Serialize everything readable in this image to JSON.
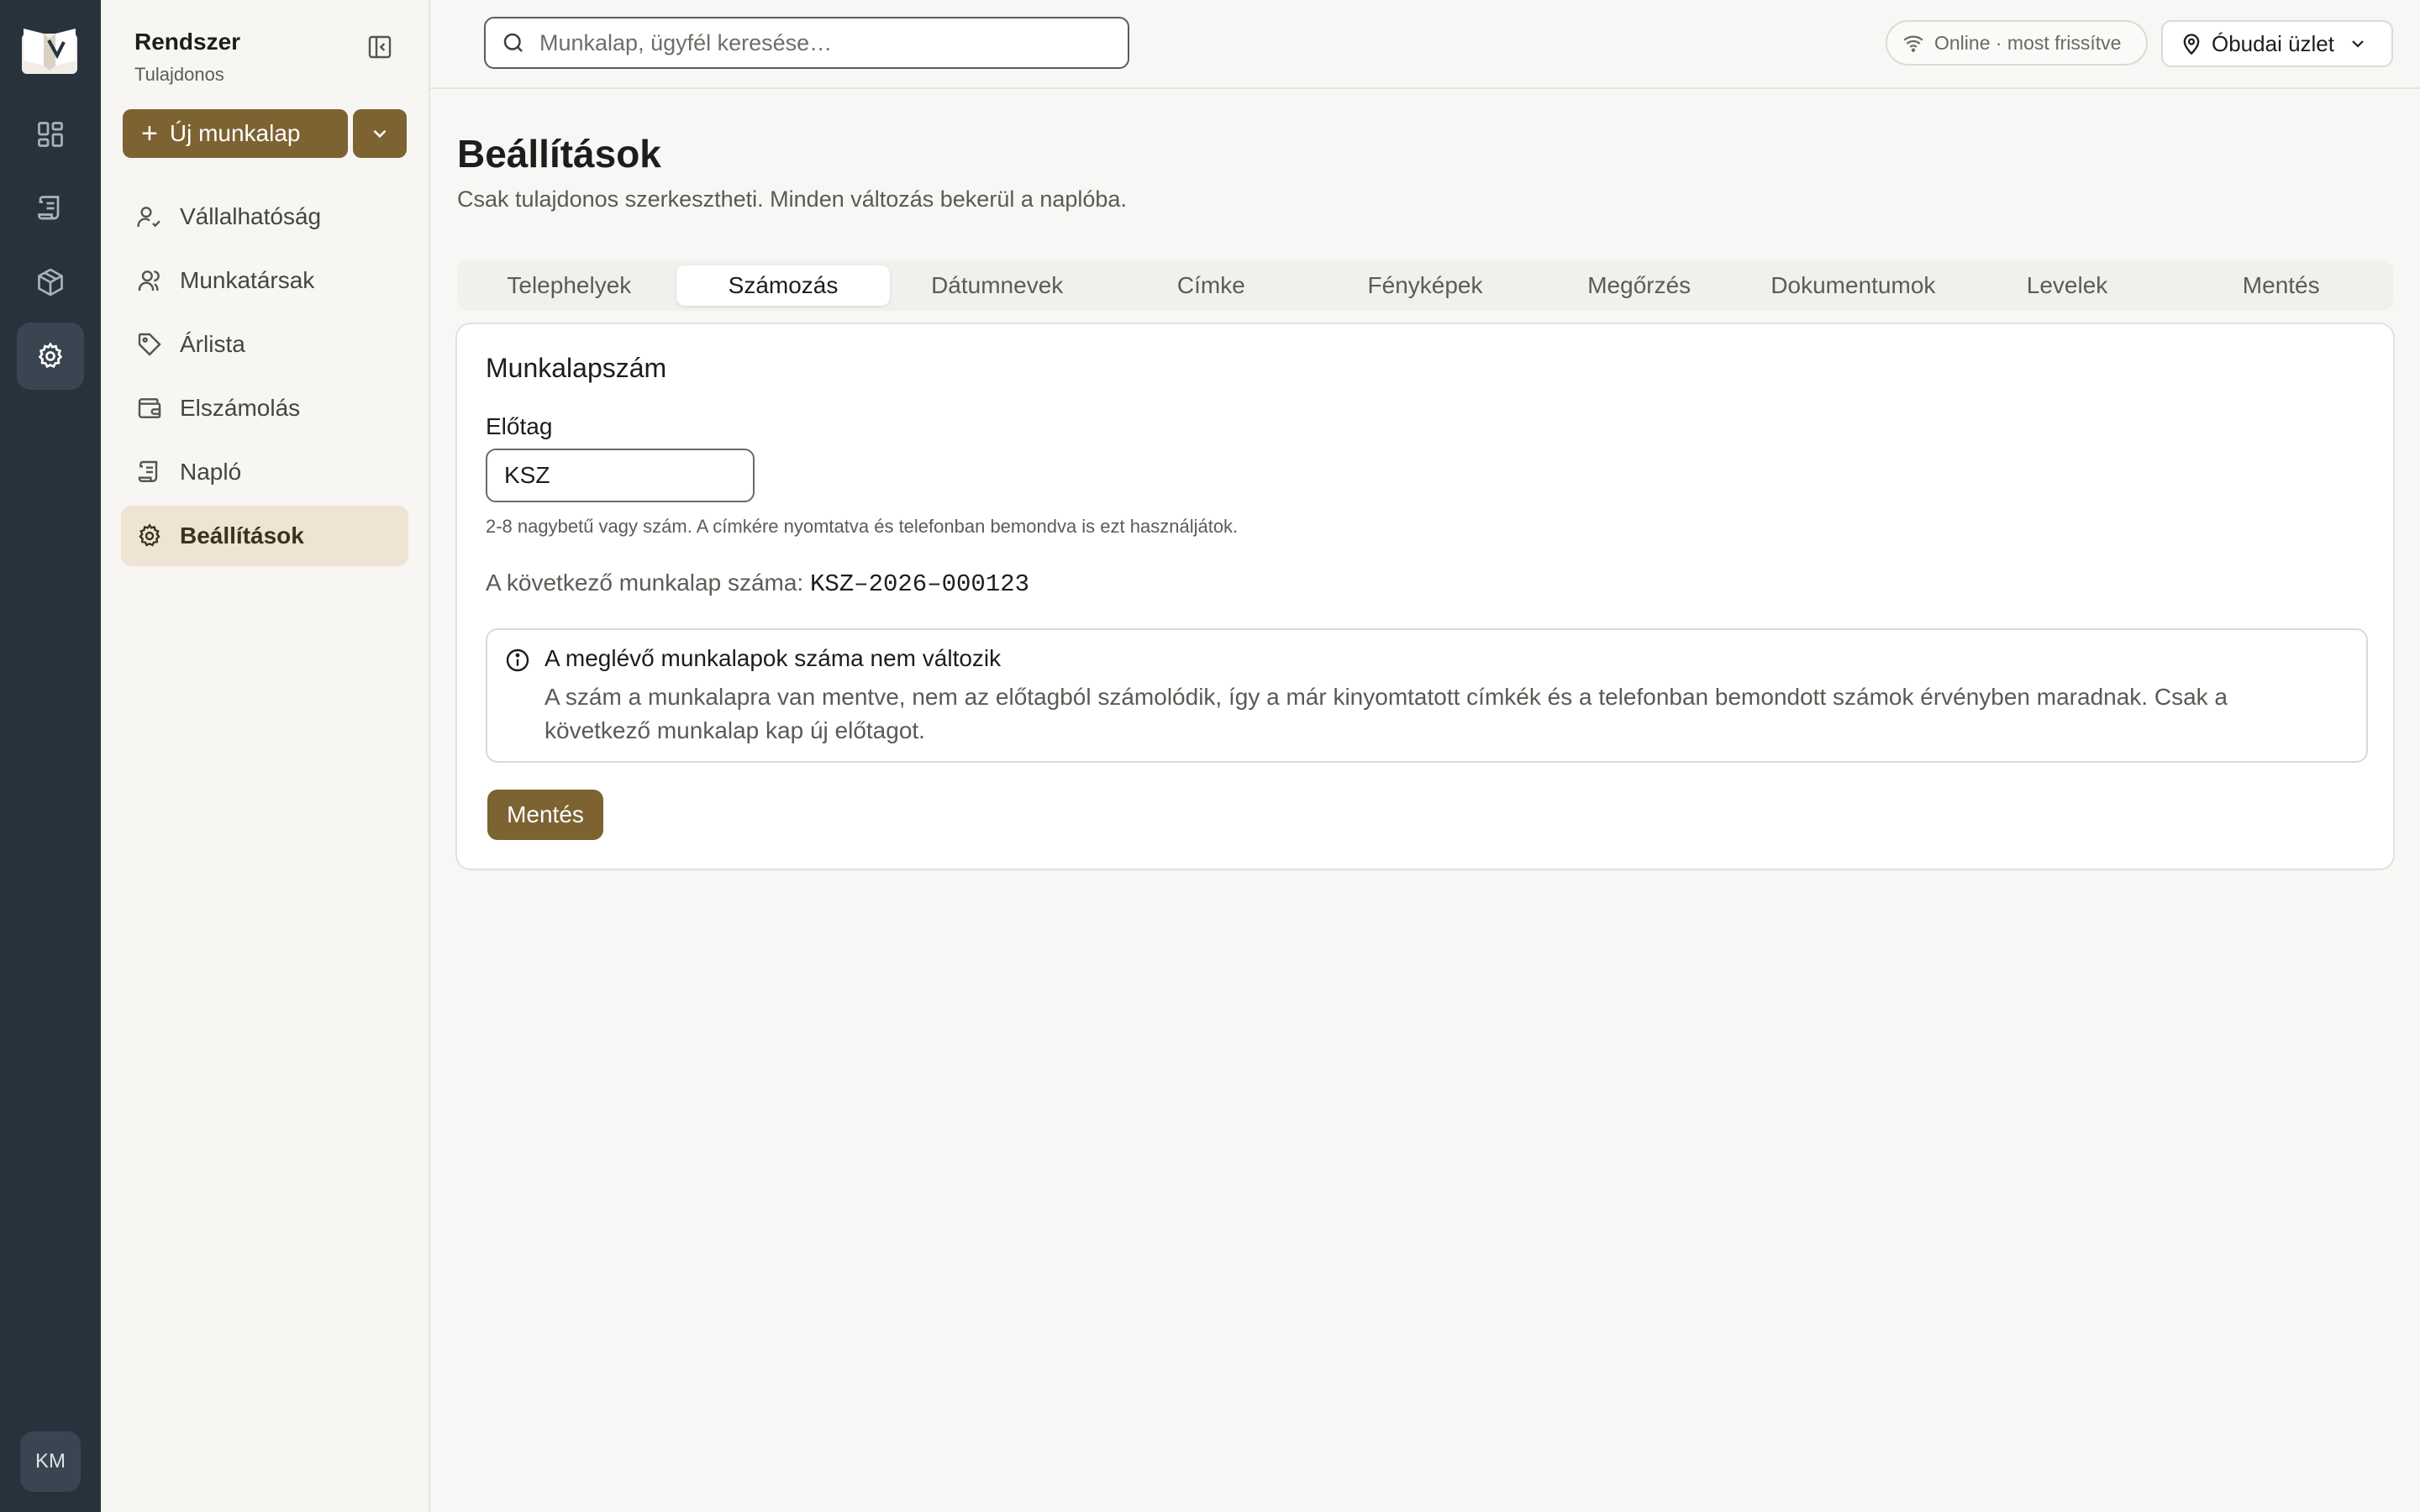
{
  "rail": {
    "items": [
      "dashboard-icon",
      "worksheets-icon",
      "inventory-icon",
      "settings-icon"
    ],
    "active": "settings-icon",
    "avatar_initials": "KM"
  },
  "sidebar": {
    "title": "Rendszer",
    "subtitle": "Tulajdonos",
    "new_button_label": "Új munkalap",
    "items": [
      {
        "label": "Vállalhatóság",
        "icon": "user-check-icon"
      },
      {
        "label": "Munkatársak",
        "icon": "users-icon"
      },
      {
        "label": "Árlista",
        "icon": "tag-icon"
      },
      {
        "label": "Elszámolás",
        "icon": "wallet-icon"
      },
      {
        "label": "Napló",
        "icon": "scroll-icon"
      },
      {
        "label": "Beállítások",
        "icon": "gear-icon",
        "active": true
      }
    ]
  },
  "topbar": {
    "search_placeholder": "Munkalap, ügyfél keresése…",
    "status": "Online · most frissítve",
    "store": "Óbudai üzlet"
  },
  "page": {
    "title": "Beállítások",
    "description": "Csak tulajdonos szerkesztheti. Minden változás bekerül a naplóba."
  },
  "tabs": [
    {
      "label": "Telephelyek"
    },
    {
      "label": "Számozás",
      "active": true
    },
    {
      "label": "Dátumnevek"
    },
    {
      "label": "Címke"
    },
    {
      "label": "Fényképek"
    },
    {
      "label": "Megőrzés"
    },
    {
      "label": "Dokumentumok"
    },
    {
      "label": "Levelek"
    },
    {
      "label": "Mentés"
    }
  ],
  "card": {
    "title": "Munkalapszám",
    "prefix_label": "Előtag",
    "prefix_value": "KSZ",
    "hint": "2-8 nagybetű vagy szám. A címkére nyomtatva és telefonban bemondva is ezt használjátok.",
    "next_label": "A következő munkalap száma:",
    "next_value": "KSZ–2026–000123",
    "notice_title": "A meglévő munkalapok száma nem változik",
    "notice_body": "A szám a munkalapra van mentve, nem az előtagból számolódik, így a már kinyomtatott címkék és a telefonban bemondott számok érvényben maradnak. Csak a következő munkalap kap új előtagot.",
    "save_label": "Mentés"
  },
  "colors": {
    "accent": "#7d6332",
    "rail": "#28323d",
    "active_nav": "#efe4d4"
  }
}
